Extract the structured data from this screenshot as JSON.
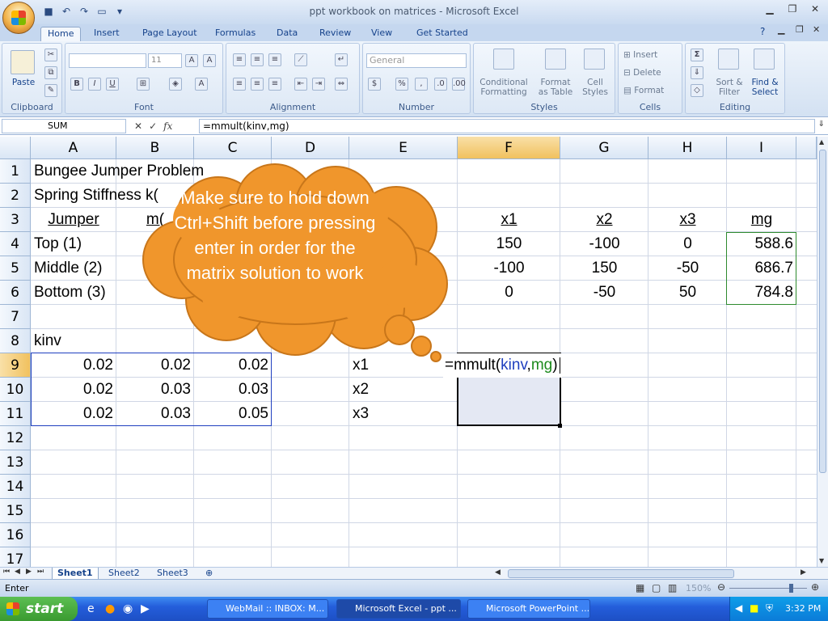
{
  "window": {
    "title": "ppt workbook on matrices - Microsoft Excel"
  },
  "tabs": [
    "Home",
    "Insert",
    "Page Layout",
    "Formulas",
    "Data",
    "Review",
    "View",
    "Get Started"
  ],
  "ribbon": {
    "clipboard": {
      "label": "Clipboard",
      "paste": "Paste"
    },
    "font": {
      "label": "Font",
      "size": "11",
      "bold": "B",
      "italic": "I",
      "underline": "U"
    },
    "alignment": {
      "label": "Alignment"
    },
    "number": {
      "label": "Number",
      "format": "General",
      "currency": "$",
      "percent": "%",
      "comma": ","
    },
    "styles": {
      "label": "Styles",
      "cond1": "Conditional",
      "cond2": "Formatting",
      "fmt1": "Format",
      "fmt2": "as Table",
      "cell1": "Cell",
      "cell2": "Styles"
    },
    "cells": {
      "label": "Cells",
      "insert": "Insert",
      "delete": "Delete",
      "format": "Format"
    },
    "editing": {
      "label": "Editing",
      "sort1": "Sort &",
      "sort2": "Filter",
      "find1": "Find &",
      "find2": "Select"
    }
  },
  "formula_bar": {
    "name_box": "SUM",
    "fx": "fx",
    "formula": "=mmult(kinv,mg)"
  },
  "columns": [
    "A",
    "B",
    "C",
    "D",
    "E",
    "F",
    "G",
    "H",
    "I"
  ],
  "rows": [
    "1",
    "2",
    "3",
    "4",
    "5",
    "6",
    "7",
    "8",
    "9",
    "10",
    "11",
    "12",
    "13",
    "14",
    "15",
    "16",
    "17"
  ],
  "cells": {
    "a1": "Bungee Jumper Problem",
    "a2": "Spring Stiffness k(",
    "a3": "Jumper",
    "b3": "m(",
    "a4": "Top (1)",
    "a5": "Middle (2)",
    "a6": "Bottom (3)",
    "f3": "x1",
    "g3": "x2",
    "h3": "x3",
    "i3": "mg",
    "f4": "150",
    "g4": "-100",
    "h4": "0",
    "i4": "588.6",
    "f5": "-100",
    "g5": "150",
    "h5": "-50",
    "i5": "686.7",
    "f6": "0",
    "g6": "-50",
    "h6": "50",
    "i6": "784.8",
    "a8": "kinv",
    "a9": "0.02",
    "b9": "0.02",
    "c9": "0.02",
    "e9": "x1",
    "a10": "0.02",
    "b10": "0.03",
    "c10": "0.03",
    "e10": "x2",
    "a11": "0.02",
    "b11": "0.03",
    "c11": "0.05",
    "e11": "x3",
    "f9_eq": "=mmult(",
    "f9_k": "kinv",
    ",": ",",
    "f9_m": "mg",
    "f9_end": ")"
  },
  "callout": {
    "text": "Make sure to hold down Ctrl+Shift before pressing enter in order for the matrix solution to work"
  },
  "sheets": [
    "Sheet1",
    "Sheet2",
    "Sheet3"
  ],
  "status": {
    "mode": "Enter",
    "zoom": "150%"
  },
  "taskbar": {
    "start": "start",
    "tasks": [
      "WebMail :: INBOX: M...",
      "Microsoft Excel - ppt ...",
      "Microsoft PowerPoint ..."
    ],
    "clock": "3:32 PM"
  },
  "colors": {
    "accent": "#15428b",
    "callout": "#f0962c",
    "formula_blue": "#1f3fbf",
    "formula_green": "#1c8a1c"
  }
}
